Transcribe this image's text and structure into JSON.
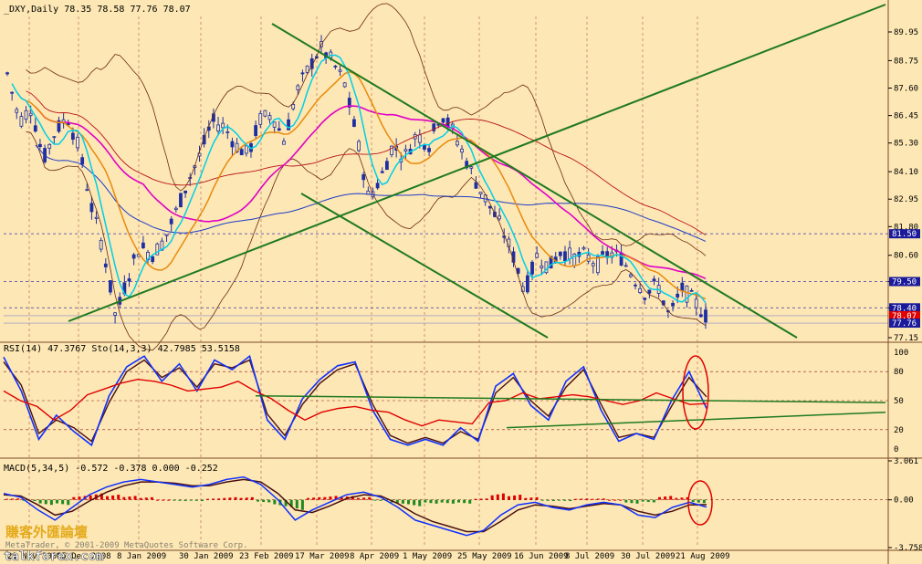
{
  "window": {
    "main_header": "_DXY,Daily  78.35 78.58 77.76 78.07",
    "rsi_header": "RSI(14) 47.3767  Sto(14,3,3) 42.7985 53.5158",
    "macd_header": "MACD(5,34,5) -0.572 -0.378 0.000 -0.252",
    "watermark_chinese": "賺客外匯論壇",
    "watermark_copyright": "MetaTrader, © 2001-2009 MetaQuotes Software Corp.",
    "watermark_site": "talkforex.com"
  },
  "colors": {
    "background": "#fde7b4",
    "grid": "#8b1a1a",
    "candles": "#1e2fa3",
    "trendlines": "#1f7a1f",
    "ma_fast": "#00cfe8",
    "ma_mid": "#e88a0c",
    "ma_slow": "#e000c8",
    "ma_long_red": "#b8141a",
    "ma_long_blue": "#1e3cc8",
    "bollinger": "#6b2a10",
    "rsi": "#e00000",
    "stoch_main": "#1030ff",
    "stoch_signal": "#4a1010",
    "macd_hist_up": "#e00000",
    "macd_hist_down": "#1f8a1f",
    "highlight_circle": "#e00000"
  },
  "chart_data": [
    {
      "type": "candlestick",
      "symbol": "_DXY",
      "timeframe": "Daily",
      "last_bar": {
        "open": 78.35,
        "high": 78.58,
        "low": 77.76,
        "close": 78.07
      },
      "ylim": [
        77.15,
        90.6
      ],
      "y_ticks": [
        89.95,
        88.75,
        87.6,
        86.45,
        85.3,
        84.1,
        82.95,
        81.8,
        80.6,
        79.5,
        78.4,
        77.15
      ],
      "price_labels": [
        81.5,
        79.5,
        78.4,
        78.07,
        77.76
      ],
      "x_tick_labels": [
        "21 Nov 2008",
        "15 Dec 2008",
        "8 Jan 2009",
        "30 Jan 2009",
        "23 Feb 2009",
        "17 Mar 2009",
        "8 Apr 2009",
        "1 May 2009",
        "25 May 2009",
        "16 Jun 2009",
        "8 Jul 2009",
        "30 Jul 2009",
        "21 Aug 2009"
      ],
      "close_path": [
        88.2,
        86.2,
        86.8,
        84.6,
        85.8,
        86.4,
        85.0,
        82.6,
        80.8,
        78.0,
        79.7,
        81.0,
        80.6,
        81.2,
        82.4,
        83.7,
        84.8,
        86.2,
        86.0,
        85.2,
        84.8,
        86.3,
        86.5,
        85.4,
        87.4,
        88.4,
        89.3,
        88.7,
        87.8,
        85.6,
        83.0,
        83.8,
        85.2,
        84.7,
        85.7,
        85.2,
        86.6,
        85.8,
        84.7,
        83.6,
        82.7,
        81.8,
        80.6,
        79.1,
        80.6,
        80.1,
        80.8,
        80.5,
        80.6,
        80.2,
        80.7,
        80.5,
        79.7,
        79.0,
        79.4,
        78.0,
        79.2,
        78.7,
        78.07
      ]
    },
    {
      "type": "line",
      "indicator": "RSI(14) / Stochastic(14,3,3)",
      "ylim": [
        0,
        100
      ],
      "y_ticks": [
        100,
        80,
        50,
        20,
        0
      ],
      "series": [
        {
          "name": "RSI(14)",
          "last": 47.3767,
          "values": [
            60,
            50,
            44,
            30,
            40,
            56,
            62,
            68,
            72,
            70,
            66,
            60,
            62,
            64,
            70,
            60,
            52,
            40,
            30,
            38,
            42,
            44,
            40,
            38,
            30,
            24,
            30,
            28,
            26,
            48,
            50,
            58,
            52,
            54,
            56,
            54,
            50,
            46,
            50,
            58,
            52,
            46,
            47
          ]
        },
        {
          "name": "Sto main",
          "last": 42.7985,
          "values": [
            95,
            60,
            10,
            35,
            18,
            4,
            55,
            85,
            96,
            70,
            88,
            60,
            92,
            82,
            96,
            30,
            10,
            52,
            72,
            86,
            90,
            40,
            10,
            4,
            10,
            4,
            22,
            8,
            65,
            78,
            45,
            30,
            70,
            85,
            40,
            8,
            16,
            10,
            50,
            80,
            42
          ]
        },
        {
          "name": "Sto signal",
          "last": 53.5158,
          "values": [
            90,
            66,
            16,
            30,
            22,
            8,
            48,
            80,
            92,
            74,
            84,
            64,
            88,
            84,
            92,
            36,
            14,
            46,
            68,
            82,
            88,
            46,
            14,
            6,
            12,
            6,
            18,
            10,
            58,
            74,
            50,
            34,
            64,
            82,
            46,
            12,
            16,
            12,
            44,
            74,
            54
          ]
        }
      ]
    },
    {
      "type": "bar",
      "indicator": "MACD(5,34,5)",
      "ylim": [
        -3.758,
        3.061
      ],
      "y_ticks": [
        3.061,
        0.0,
        -3.758
      ],
      "series": [
        {
          "name": "MACD",
          "last": -0.572,
          "values": [
            0.5,
            0.2,
            -0.8,
            -1.6,
            -0.6,
            0.4,
            1.0,
            1.4,
            1.6,
            1.4,
            1.2,
            1.0,
            1.2,
            1.6,
            1.8,
            1.2,
            0.0,
            -1.6,
            -0.8,
            -0.2,
            0.4,
            0.6,
            0.2,
            -0.6,
            -1.6,
            -2.0,
            -2.4,
            -2.8,
            -2.4,
            -1.2,
            -0.4,
            -0.2,
            -0.6,
            -0.8,
            -0.4,
            -0.2,
            -0.4,
            -1.2,
            -1.4,
            -0.6,
            -0.2,
            -0.572
          ]
        },
        {
          "name": "Signal",
          "last": -0.378,
          "values": [
            0.4,
            0.3,
            -0.4,
            -1.2,
            -0.9,
            -0.1,
            0.6,
            1.1,
            1.4,
            1.4,
            1.3,
            1.1,
            1.1,
            1.4,
            1.6,
            1.4,
            0.5,
            -0.8,
            -1.0,
            -0.5,
            0.1,
            0.4,
            0.3,
            -0.3,
            -1.1,
            -1.7,
            -2.1,
            -2.5,
            -2.5,
            -1.7,
            -0.8,
            -0.4,
            -0.5,
            -0.7,
            -0.5,
            -0.3,
            -0.4,
            -0.9,
            -1.2,
            -0.9,
            -0.4,
            -0.378
          ]
        },
        {
          "name": "OsMA",
          "values": [
            0.1,
            -0.1,
            -0.4,
            -0.4,
            0.3,
            0.5,
            0.4,
            0.3,
            0.2,
            0.0,
            -0.1,
            -0.1,
            0.1,
            0.2,
            0.2,
            -0.2,
            -0.5,
            -0.8,
            0.2,
            0.3,
            0.3,
            0.2,
            -0.1,
            -0.3,
            -0.5,
            -0.3,
            -0.3,
            -0.3,
            0.1,
            0.5,
            0.4,
            0.2,
            -0.1,
            -0.1,
            0.1,
            0.1,
            0.0,
            -0.3,
            -0.2,
            0.3,
            0.2,
            -0.252
          ]
        }
      ]
    }
  ]
}
